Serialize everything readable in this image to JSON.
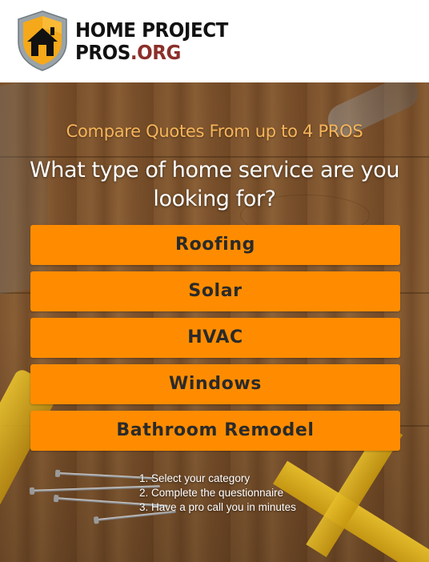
{
  "header": {
    "logo_line1": "HOME PROJECT",
    "logo_line2_part1": "PROS",
    "logo_line2_part2": ".ORG"
  },
  "hero": {
    "tagline": "Compare Quotes From up to 4 PROS",
    "question": "What type of home service are you looking for?"
  },
  "options": [
    {
      "label": "Roofing"
    },
    {
      "label": "Solar"
    },
    {
      "label": "HVAC"
    },
    {
      "label": "Windows"
    },
    {
      "label": "Bathroom Remodel"
    }
  ],
  "steps": [
    "1. Select your category",
    "2. Complete the questionnaire",
    "3. Have a pro call you in minutes"
  ],
  "colors": {
    "button_bg": "#ff8c00",
    "tagline": "#f7b55a",
    "logo_org": "#8c2f2a",
    "shield_yellow": "#f5a91a"
  },
  "icons": {
    "logo": "house-shield-icon"
  }
}
